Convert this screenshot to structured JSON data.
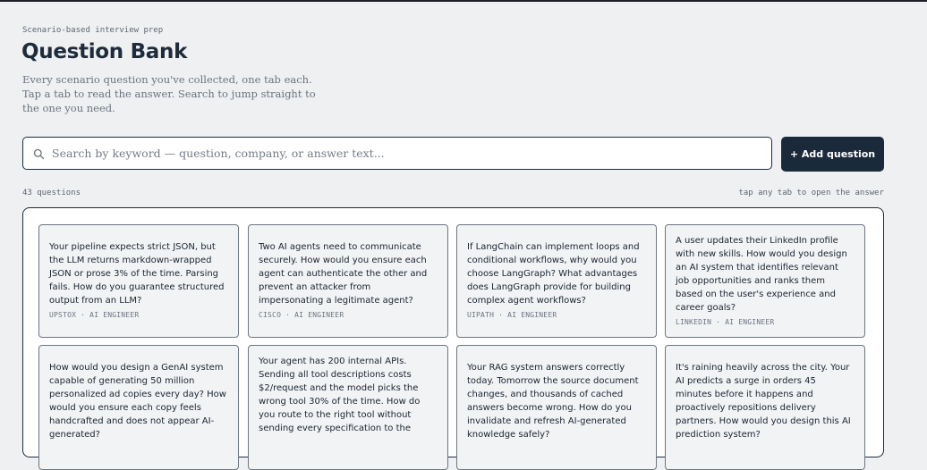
{
  "header": {
    "eyebrow": "Scenario-based interview prep",
    "title": "Question Bank",
    "subtitle": "Every scenario question you've collected, one tab each. Tap a tab to read the answer. Search to jump straight to the one you need."
  },
  "search": {
    "placeholder": "Search by keyword — question, company, or answer text...",
    "value": ""
  },
  "toolbar": {
    "add_label": "+ Add question"
  },
  "summary": {
    "count_label": "43 questions",
    "hint": "tap any tab to open the answer"
  },
  "questions": [
    {
      "text": "Your pipeline expects strict JSON, but the LLM returns markdown-wrapped JSON or prose 3% of the time. Parsing fails. How do you guarantee structured output from an LLM?",
      "company": "UPSTOX",
      "role": "AI ENGINEER"
    },
    {
      "text": "Two AI agents need to communicate securely. How would you ensure each agent can authenticate the other and prevent an attacker from impersonating a legitimate agent?",
      "company": "CISCO",
      "role": "AI ENGINEER"
    },
    {
      "text": "If LangChain can implement loops and conditional workflows, why would you choose LangGraph? What advantages does LangGraph provide for building complex agent workflows?",
      "company": "UIPATH",
      "role": "AI ENGINEER"
    },
    {
      "text": "A user updates their LinkedIn profile with new skills. How would you design an AI system that identifies relevant job opportunities and ranks them based on the user's experience and career goals?",
      "company": "LINKEDIN",
      "role": "AI ENGINEER"
    },
    {
      "text": "How would you design a GenAI system capable of generating 50 million personalized ad copies every day? How would you ensure each copy feels handcrafted and does not appear AI-generated?",
      "company": "",
      "role": ""
    },
    {
      "text": "Your agent has 200 internal APIs. Sending all tool descriptions costs $2/request and the model picks the wrong tool 30% of the time. How do you route to the right tool without sending every specification to the",
      "company": "",
      "role": ""
    },
    {
      "text": "Your RAG system answers correctly today. Tomorrow the source document changes, and thousands of cached answers become wrong. How do you invalidate and refresh AI-generated knowledge safely?",
      "company": "",
      "role": ""
    },
    {
      "text": "It's raining heavily across the city. Your AI predicts a surge in orders 45 minutes before it happens and proactively repositions delivery partners. How would you design this AI prediction system?",
      "company": "",
      "role": ""
    }
  ]
}
